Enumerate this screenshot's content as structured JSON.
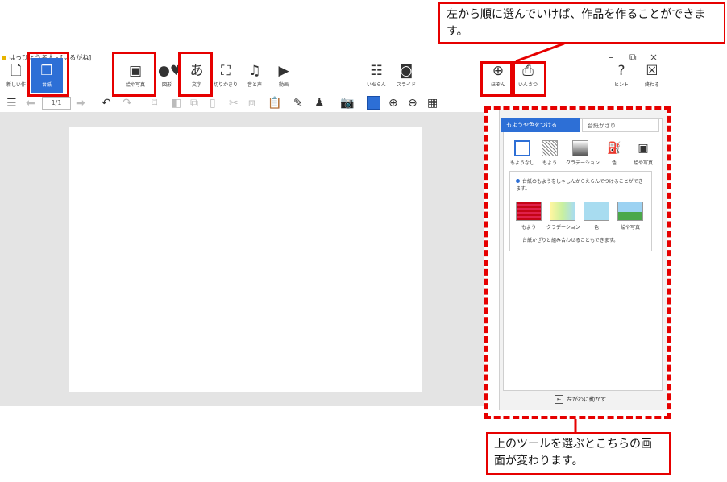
{
  "app": {
    "title": "はっぴょう名人 - [はるがね]"
  },
  "toolbar": {
    "new": {
      "label": "新しい作",
      "icon": "new-document-icon"
    },
    "paper": {
      "label": "台紙",
      "icon": "paper-stack-icon"
    },
    "picture": {
      "label": "絵や写真",
      "icon": "picture-icon"
    },
    "shape": {
      "label": "図形",
      "icon": "shapes-icon"
    },
    "text": {
      "label": "文字",
      "icon": "text-a-icon",
      "glyph": "あ"
    },
    "crop": {
      "label": "切りかきり",
      "icon": "crop-icon"
    },
    "sound": {
      "label": "音と声",
      "icon": "sound-icon"
    },
    "video": {
      "label": "動画",
      "icon": "video-icon"
    },
    "layout": {
      "label": "いちらん",
      "icon": "grid-icon"
    },
    "slide": {
      "label": "スライド",
      "icon": "projector-icon"
    },
    "save": {
      "label": "ほぞん",
      "icon": "save-icon"
    },
    "print": {
      "label": "いんさつ",
      "icon": "print-icon"
    },
    "hint": {
      "label": "ヒント",
      "icon": "hint-icon"
    },
    "quit": {
      "label": "終わる",
      "icon": "close-box-icon"
    }
  },
  "toolbar2": {
    "page_counter": "1/1"
  },
  "callouts": {
    "top": "左から順に選んでいけば、作品を作ることができます。",
    "bottom": "上のツールを選ぶとこちらの画面が変わります。"
  },
  "panel": {
    "tab_active": "もようや色をつける",
    "tab_inactive": "台紙かざり",
    "tools": [
      {
        "label": "もようなし",
        "icon": "no-pattern-icon"
      },
      {
        "label": "もよう",
        "icon": "pattern-icon"
      },
      {
        "label": "クラデーション",
        "icon": "gradient-icon"
      },
      {
        "label": "色",
        "icon": "paint-bucket-icon"
      },
      {
        "label": "絵や写真",
        "icon": "picture-icon"
      }
    ],
    "info": "台紙のもようをしゃしんからえらんでつけることができます。",
    "swatches": [
      {
        "label": "もよう",
        "color": "#e0204a"
      },
      {
        "label": "クラデーション",
        "color": "#c8f0a0"
      },
      {
        "label": "色",
        "color": "#a8dcf0"
      },
      {
        "label": "絵や写真",
        "color": "#4aa84a"
      }
    ],
    "footer": "台紙かざりと組み合わせることもできます。",
    "move_left": "左がわに動かす"
  }
}
